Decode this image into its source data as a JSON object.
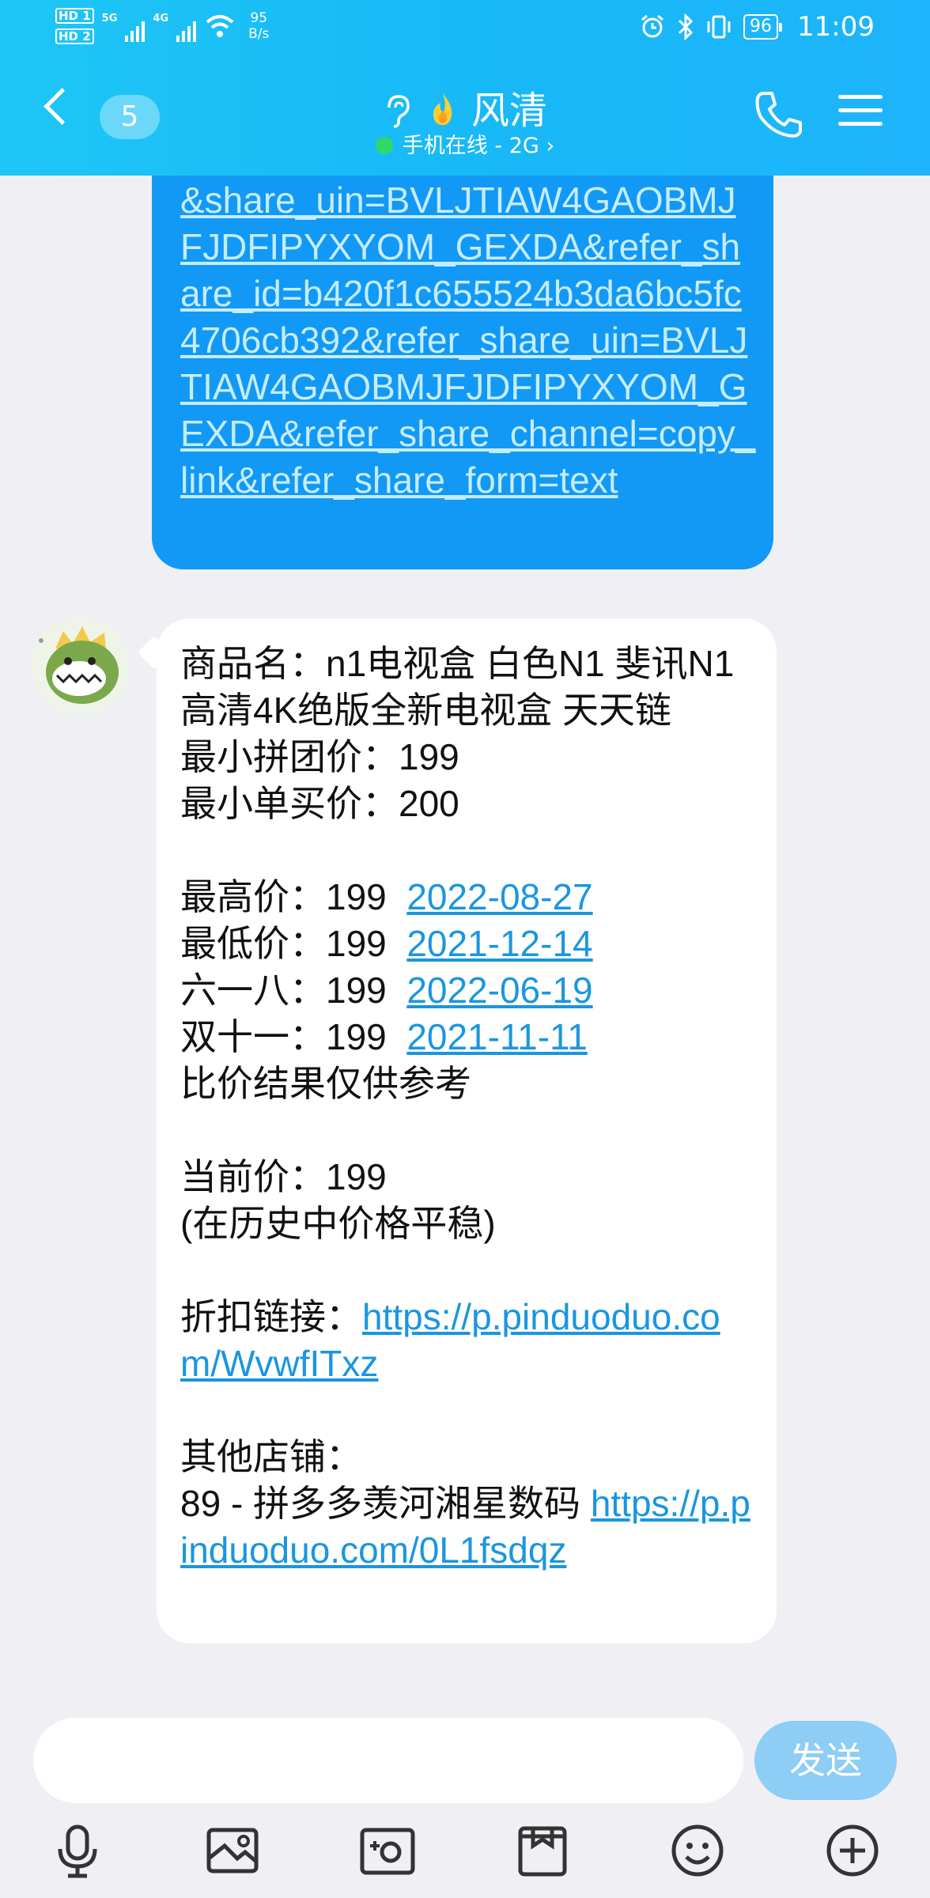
{
  "status_bar": {
    "sim1": "HD 1",
    "sim2": "HD 2",
    "net_5g": "5G",
    "net_4g": "4G",
    "speed_value": "95",
    "speed_unit": "B/s",
    "battery": "96",
    "time": "11:09"
  },
  "header": {
    "unread_count": "5",
    "contact_name": "风清",
    "presence": "手机在线 - 2G",
    "presence_arrow": "›"
  },
  "sent_message": {
    "text": "&share_uin=BVLJTIAW4GAOBMJFJDFIPYXYOM_GEXDA&refer_share_id=b420f1c655524b3da6bc5fc4706cb392&refer_share_uin=BVLJTIAW4GAOBMJFJDFIPYXYOM_GEXDA&refer_share_channel=copy_link&refer_share_form=text"
  },
  "received_message": {
    "product_line": "商品名：n1电视盒 白色N1 斐讯N1 高清4K绝版全新电视盒 天天链",
    "min_group_price": "最小拼团价：199",
    "min_single_price": "最小单买价：200",
    "highest_label": "最高价：199  ",
    "highest_date": "2022-08-27",
    "lowest_label": "最低价：199  ",
    "lowest_date": "2021-12-14",
    "six18_label": "六一八：199  ",
    "six18_date": "2022-06-19",
    "double11_label": "双十一：199  ",
    "double11_date": "2021-11-11",
    "disclaimer": "比价结果仅供参考",
    "current_price": "当前价：199",
    "trend": "(在历史中价格平稳)",
    "discount_label": "折扣链接：",
    "discount_link": "https://p.pinduoduo.com/WvwfITxz",
    "other_shops_label": "其他店铺：",
    "shop_prefix": "89 - 拼多多羡河湘星数码 ",
    "shop_link": "https://p.pinduoduo.com/0L1fsdqz"
  },
  "composer": {
    "input_value": "",
    "send_label": "发送"
  },
  "toolbar_icons": [
    "microphone-icon",
    "image-icon",
    "camera-icon",
    "file-icon",
    "emoji-icon",
    "plus-icon"
  ]
}
